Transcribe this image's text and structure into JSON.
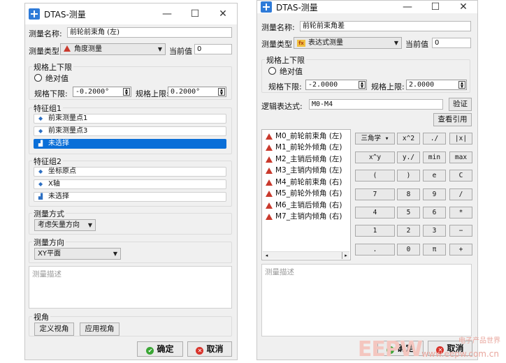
{
  "left": {
    "title": "DTAS-测量",
    "controls": {
      "minimize": "—",
      "maximize": "☐",
      "close": "✕"
    },
    "name_label": "测量名称:",
    "name_value": "前轮前束角 (左)",
    "type_label": "测量类型",
    "type_value": "角度测量",
    "current_label": "当前值",
    "current_value": "0",
    "limits_group": "规格上下限",
    "absolute_label": "绝对值",
    "lower_label": "规格下限:",
    "lower_value": "-0.2000°",
    "upper_label": "规格上限:",
    "upper_value": "0.2000°",
    "feature1_group": "特征组1",
    "feature1_items": [
      "前束测量点1",
      "前束测量点3",
      "未选择"
    ],
    "feature2_group": "特征组2",
    "feature2_items": [
      "坐标原点",
      "X轴",
      "未选择"
    ],
    "method_group": "测量方式",
    "method_value": "考虑矢量方向",
    "direction_group": "测量方向",
    "direction_value": "XY平面",
    "description_placeholder": "测量描述",
    "view_group": "视角",
    "define_view": "定义视角",
    "apply_view": "应用视角",
    "ok": "确定",
    "cancel": "取消"
  },
  "right": {
    "title": "DTAS-测量",
    "controls": {
      "minimize": "—",
      "maximize": "☐",
      "close": "✕"
    },
    "name_label": "测量名称:",
    "name_value": "前轮前束角差",
    "type_label": "测量类型",
    "type_value": "表达式测量",
    "current_label": "当前值",
    "current_value": "0",
    "limits_group": "规格上下限",
    "absolute_label": "绝对值",
    "lower_label": "规格下限:",
    "lower_value": "-2.0000",
    "upper_label": "规格上限:",
    "upper_value": "2.0000",
    "expr_label": "逻辑表达式:",
    "expr_value": "M0-M4",
    "verify": "验证",
    "view_refs": "查看引用",
    "measure_list": [
      "M0_前轮前束角 (左)",
      "M1_前轮外倾角 (左)",
      "M2_主销后倾角 (左)",
      "M3_主销内倾角 (左)",
      "M4_前轮前束角 (右)",
      "M5_前轮外倾角 (右)",
      "M6_主销后倾角 (右)",
      "M7_主销内倾角 (右)"
    ],
    "keypad": {
      "trig": "三角学",
      "row1": [
        "x^2",
        "./",
        "|x|"
      ],
      "row2": [
        "x^y",
        "y./",
        "min",
        "max"
      ],
      "row3": [
        "(",
        ")",
        "e",
        "C"
      ],
      "row4": [
        "7",
        "8",
        "9",
        "/"
      ],
      "row5": [
        "4",
        "5",
        "6",
        "*"
      ],
      "row6": [
        "1",
        "2",
        "3",
        "−"
      ],
      "row7": [
        ".",
        "0",
        "π",
        "+"
      ]
    },
    "description_placeholder": "测量描述",
    "ok": "确定",
    "cancel": "取消"
  },
  "watermark": {
    "logo": "EEPW",
    "site": "www.eepw.com.cn",
    "cn": "电子产品世界"
  }
}
